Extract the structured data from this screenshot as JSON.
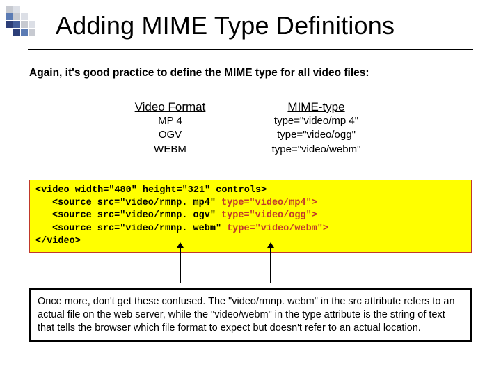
{
  "title": "Adding MIME Type Definitions",
  "intro": "Again, it's good practice to define the MIME type for all video files:",
  "table": {
    "col1_head": "Video Format",
    "col2_head": "MIME-type",
    "rows": [
      {
        "fmt": "MP 4",
        "mime": "type=\"video/mp 4\""
      },
      {
        "fmt": "OGV",
        "mime": "type=\"video/ogg\""
      },
      {
        "fmt": "WEBM",
        "mime": "type=\"video/webm\""
      }
    ]
  },
  "code": {
    "l1a": "<video width=\"480\" height=\"321\" controls>",
    "l2a": "<source src=\"video/rmnp. mp4\" ",
    "l2b": "type=\"video/mp4\">",
    "l3a": "<source src=\"video/rmnp. ogv\" ",
    "l3b": "type=\"video/ogg\">",
    "l4a": "<source src=\"video/rmnp. webm\" ",
    "l4b": "type=\"video/webm\">",
    "l5a": "</video>"
  },
  "note": "Once more, don't get these confused.  The \"video/rmnp. webm\" in the src attribute refers to an actual file on the web server, while the \"video/webm\" in the type attribute is the string of text that tells the browser which file format to expect but doesn't refer to an actual location."
}
